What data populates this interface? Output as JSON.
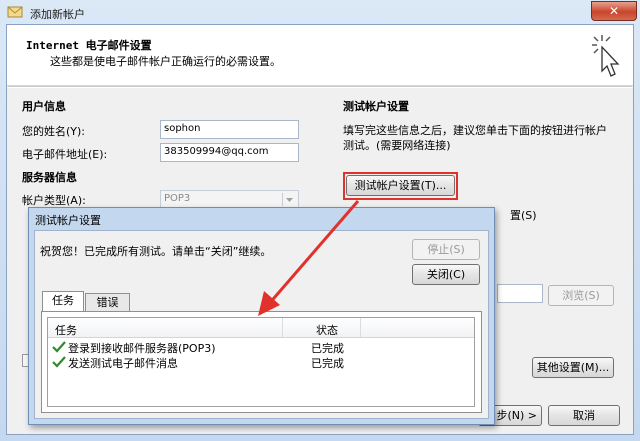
{
  "window": {
    "title": "添加新帐户",
    "close_label": "✕"
  },
  "header": {
    "title": "Internet 电子邮件设置",
    "subtitle": "这些都是使电子邮件帐户正确运行的必需设置。"
  },
  "user_info": {
    "section_title": "用户信息",
    "name_label": "您的姓名(Y):",
    "name_value": "sophon",
    "email_label": "电子邮件地址(E):",
    "email_value": "383509994@qq.com"
  },
  "server_info": {
    "section_title": "服务器信息",
    "account_type_label": "帐户类型(A):",
    "account_type_value": "POP3"
  },
  "test_settings": {
    "section_title": "测试帐户设置",
    "description_line1": "填写完这些信息之后，建议您单击下面的按钮进行帐户",
    "description_line2": "测试。(需要网络连接)",
    "test_button": "测试帐户设置(T)...",
    "partial_text": "置(S)"
  },
  "bottom_buttons": {
    "browse": "浏览(S)",
    "more_settings": "其他设置(M)...",
    "next": "步(N) >",
    "cancel": "取消"
  },
  "dialog": {
    "title": "测试帐户设置",
    "message": "祝贺您！已完成所有测试。请单击“关闭”继续。",
    "stop_button": "停止(S)",
    "close_button": "关闭(C)",
    "tabs": [
      {
        "label": "任务",
        "active": true
      },
      {
        "label": "错误",
        "active": false
      }
    ],
    "columns": {
      "task": "任务",
      "status": "状态"
    },
    "rows": [
      {
        "task": "登录到接收邮件服务器(POP3)",
        "status": "已完成"
      },
      {
        "task": "发送测试电子邮件消息",
        "status": "已完成"
      }
    ]
  },
  "colors": {
    "accent_red": "#e0322b",
    "check_green": "#2e8b2e"
  }
}
